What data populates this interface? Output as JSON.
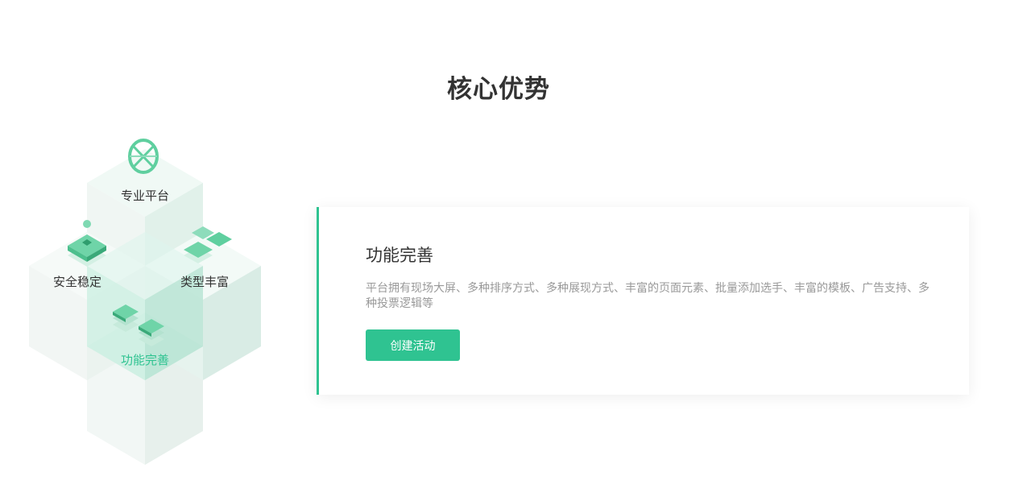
{
  "section": {
    "title": "核心优势"
  },
  "features": [
    {
      "label": "专业平台",
      "icon": "globe-icon"
    },
    {
      "label": "安全稳定",
      "icon": "stable-layers-icon"
    },
    {
      "label": "类型丰富",
      "icon": "tiles-icon"
    },
    {
      "label": "功能完善",
      "icon": "stacked-boxes-icon",
      "active": true
    }
  ],
  "detail": {
    "title": "功能完善",
    "description": "平台拥有现场大屏、多种排序方式、多种展现方式、丰富的页面元素、批量添加选手、丰富的模板、广告支持、多种投票逻辑等",
    "button_label": "创建活动"
  },
  "colors": {
    "accent": "#2fc391",
    "title": "#333333",
    "muted": "#999999"
  }
}
